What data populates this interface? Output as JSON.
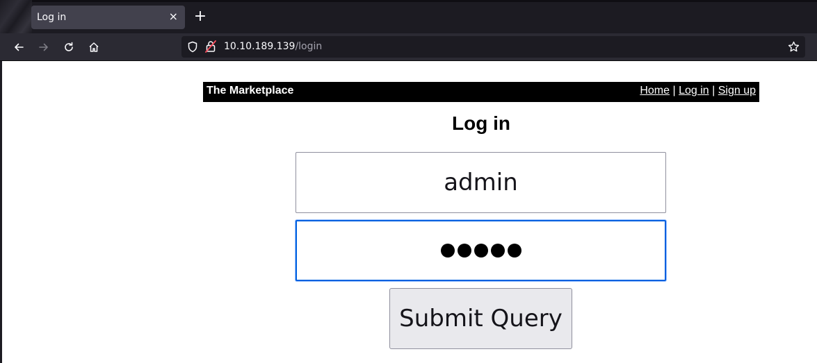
{
  "browser": {
    "tab_title": "Log in",
    "tab_close_glyph": "×",
    "new_tab_glyph": "+",
    "url_host": "10.10.189.139",
    "url_path": "/login",
    "icons": [
      "back-icon",
      "forward-icon",
      "reload-icon",
      "home-icon",
      "shield-icon",
      "insecure-lock-icon",
      "bookmark-star-icon"
    ]
  },
  "site": {
    "brand": "The Marketplace",
    "nav": [
      {
        "label": "Home"
      },
      {
        "label": "Log in"
      },
      {
        "label": "Sign up"
      }
    ],
    "separator": "|"
  },
  "form": {
    "title": "Log in",
    "username_value": "admin",
    "password_length": 5,
    "submit_label": "Submit Query"
  },
  "colors": {
    "chrome_dark": "#1c1b22",
    "tab_active": "#42414d",
    "focus_ring": "#0060df",
    "button_bg": "#e9e9ed"
  }
}
